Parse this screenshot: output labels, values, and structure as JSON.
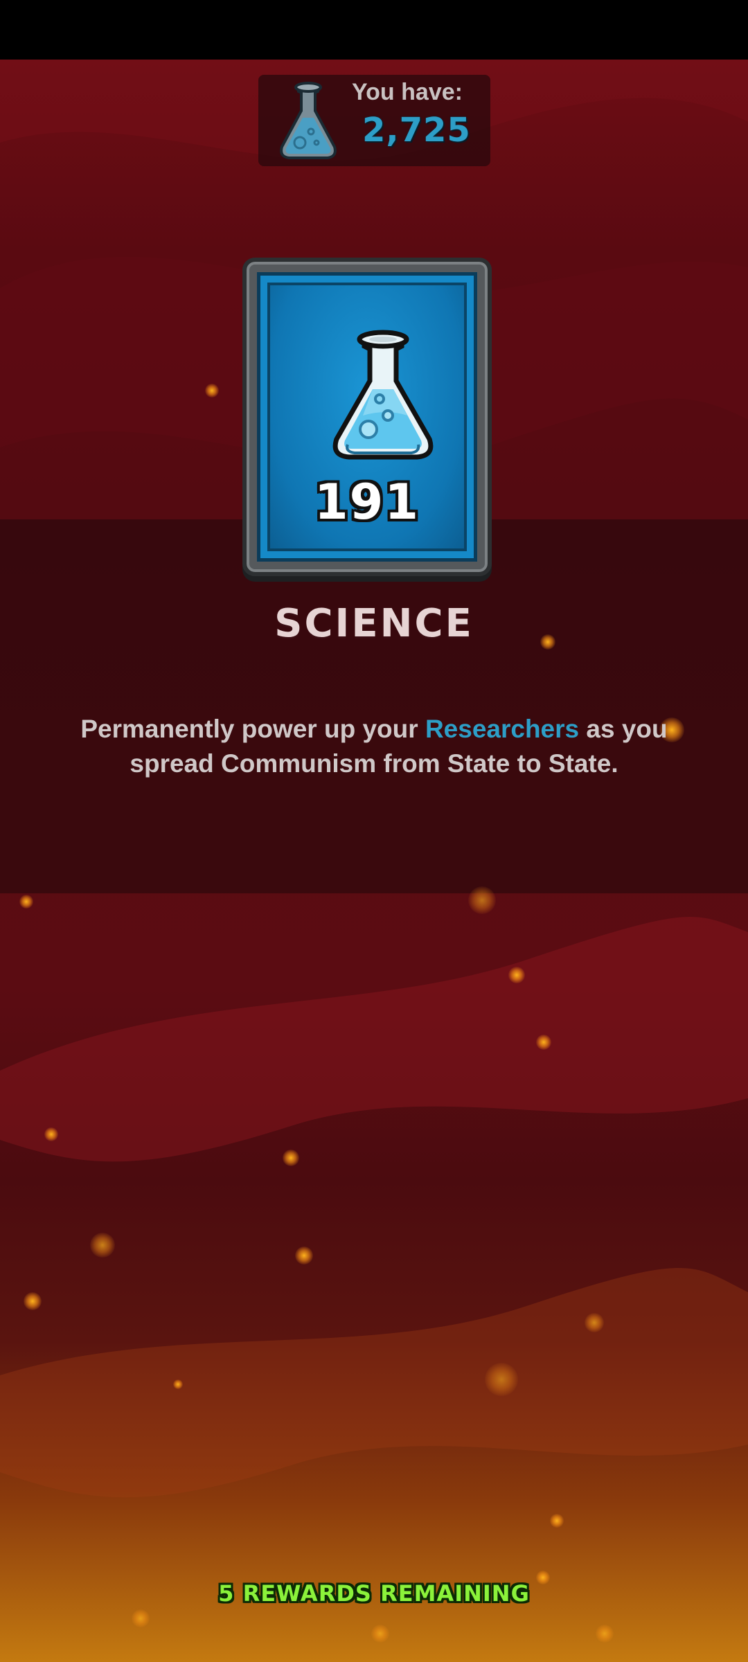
{
  "currency": {
    "label": "You have:",
    "value": "2,725",
    "icon": "flask-icon"
  },
  "reward": {
    "amount": "191",
    "title": "SCIENCE",
    "icon": "flask-icon"
  },
  "description": {
    "part1": "Permanently power up your ",
    "highlight": "Researchers",
    "part2": " as you spread Communism from State to State."
  },
  "footer": {
    "remaining": "5 REWARDS REMAINING"
  },
  "colors": {
    "accent_blue": "#2d9ec7",
    "remaining_green": "#8bf23a",
    "background_red": "#5a0a11"
  }
}
